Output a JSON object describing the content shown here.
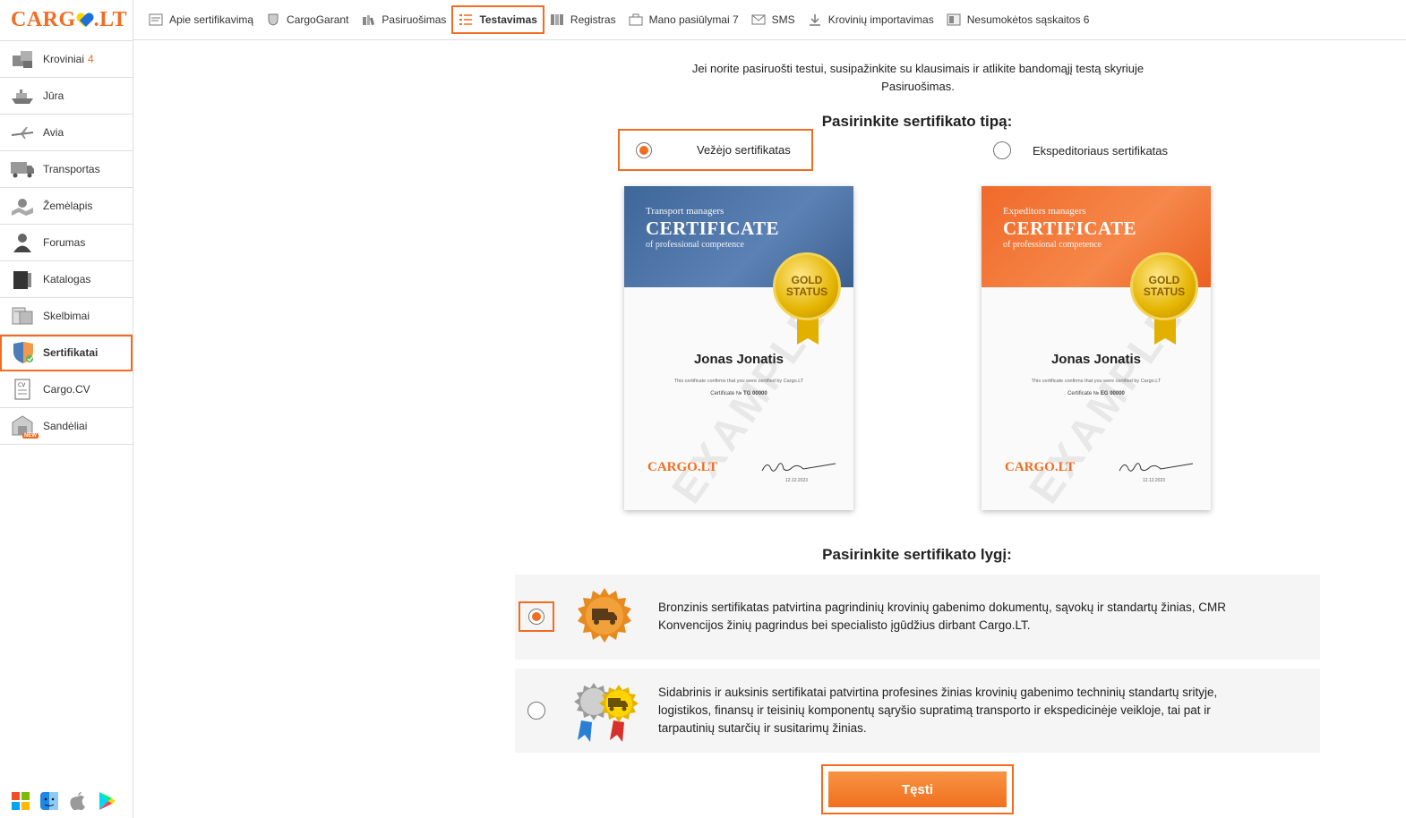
{
  "logo": {
    "left": "CARG",
    "right": "LT",
    "dot": "."
  },
  "sidebar": {
    "items": [
      {
        "label": "Kroviniai",
        "count": "4",
        "icon": "boxes-icon"
      },
      {
        "label": "Jūra",
        "icon": "ship-icon"
      },
      {
        "label": "Avia",
        "icon": "airplane-icon"
      },
      {
        "label": "Transportas",
        "icon": "truck-icon"
      },
      {
        "label": "Žemėlapis",
        "icon": "map-icon"
      },
      {
        "label": "Forumas",
        "icon": "forum-icon"
      },
      {
        "label": "Katalogas",
        "icon": "catalog-icon"
      },
      {
        "label": "Skelbimai",
        "icon": "ads-icon"
      },
      {
        "label": "Sertifikatai",
        "icon": "shield-icon"
      },
      {
        "label": "Cargo.CV",
        "icon": "cv-icon"
      },
      {
        "label": "Sandėliai",
        "icon": "warehouse-icon",
        "badge": "NEW"
      }
    ],
    "platforms": [
      "windows-icon",
      "finder-icon",
      "apple-icon",
      "google-play-icon"
    ]
  },
  "topnav": {
    "items": [
      {
        "label": "Apie sertifikavimą",
        "icon": "document-icon"
      },
      {
        "label": "CargoGarant",
        "icon": "shield-icon"
      },
      {
        "label": "Pasiruošimas",
        "icon": "books-icon"
      },
      {
        "label": "Testavimas",
        "icon": "checklist-icon"
      },
      {
        "label": "Registras",
        "icon": "registry-icon"
      },
      {
        "label": "Mano pasiūlymai 7",
        "icon": "briefcase-icon"
      },
      {
        "label": "SMS",
        "icon": "envelope-icon"
      },
      {
        "label": "Krovinių importavimas",
        "icon": "download-icon"
      },
      {
        "label": "Nesumokėtos sąskaitos 6",
        "icon": "invoice-icon"
      }
    ]
  },
  "main": {
    "intro": "Jei norite pasiruošti testui, susipažinkite su klausimais ir atlikite bandomąjį testą skyriuje Pasiruošimas.",
    "type_heading": "Pasirinkite sertifikato tipą:",
    "type_options": [
      "Vežėjo sertifikatas",
      "Ekspeditoriaus sertifikatas"
    ],
    "certificates": [
      {
        "small": "Transport managers",
        "big": "CERTIFICATE",
        "sub": "of professional competence",
        "medal_line1": "GOLD",
        "medal_line2": "STATUS",
        "watermark": "EXAMPLE",
        "name": "Jonas Jonatis",
        "confirm": "This certificate confirms that you were certified by Cargo.LT",
        "number_label": "Certificate №",
        "number": "TG 00000",
        "logo": "CARGO.LT",
        "date": "12.12.2023",
        "color": "#4a6fa5"
      },
      {
        "small": "Expeditors managers",
        "big": "CERTIFICATE",
        "sub": "of professional competence",
        "medal_line1": "GOLD",
        "medal_line2": "STATUS",
        "watermark": "EXAMPLE",
        "name": "Jonas Jonatis",
        "confirm": "This certificate confirms that you were certified by Cargo.LT",
        "number_label": "Certificate №",
        "number": "EG 00000",
        "logo": "CARGO.LT",
        "date": "12.12.2023",
        "color": "#f26c2c"
      }
    ],
    "level_heading": "Pasirinkite sertifikato lygį:",
    "levels": [
      {
        "text": "Bronzinis sertifikatas patvirtina pagrindinių krovinių gabenimo dokumentų, sąvokų ir standartų žinias, CMR Konvencijos žinių pagrindus bei specialisto įgūdžius dirbant Cargo.LT.",
        "icon": "bronze-badge-icon"
      },
      {
        "text": "Sidabrinis ir auksinis sertifikatai patvirtina profesines žinias krovinių gabenimo techninių standartų srityje, logistikos, finansų ir teisinių komponentų sąryšio supratimą transporto ir ekspedicinėje veikloje, tai pat ir tarpautinių sutarčių ir susitarimų žinias.",
        "icon": "silver-gold-badge-icon"
      }
    ],
    "continue_label": "Tęsti"
  },
  "colors": {
    "accent": "#f26c21"
  }
}
